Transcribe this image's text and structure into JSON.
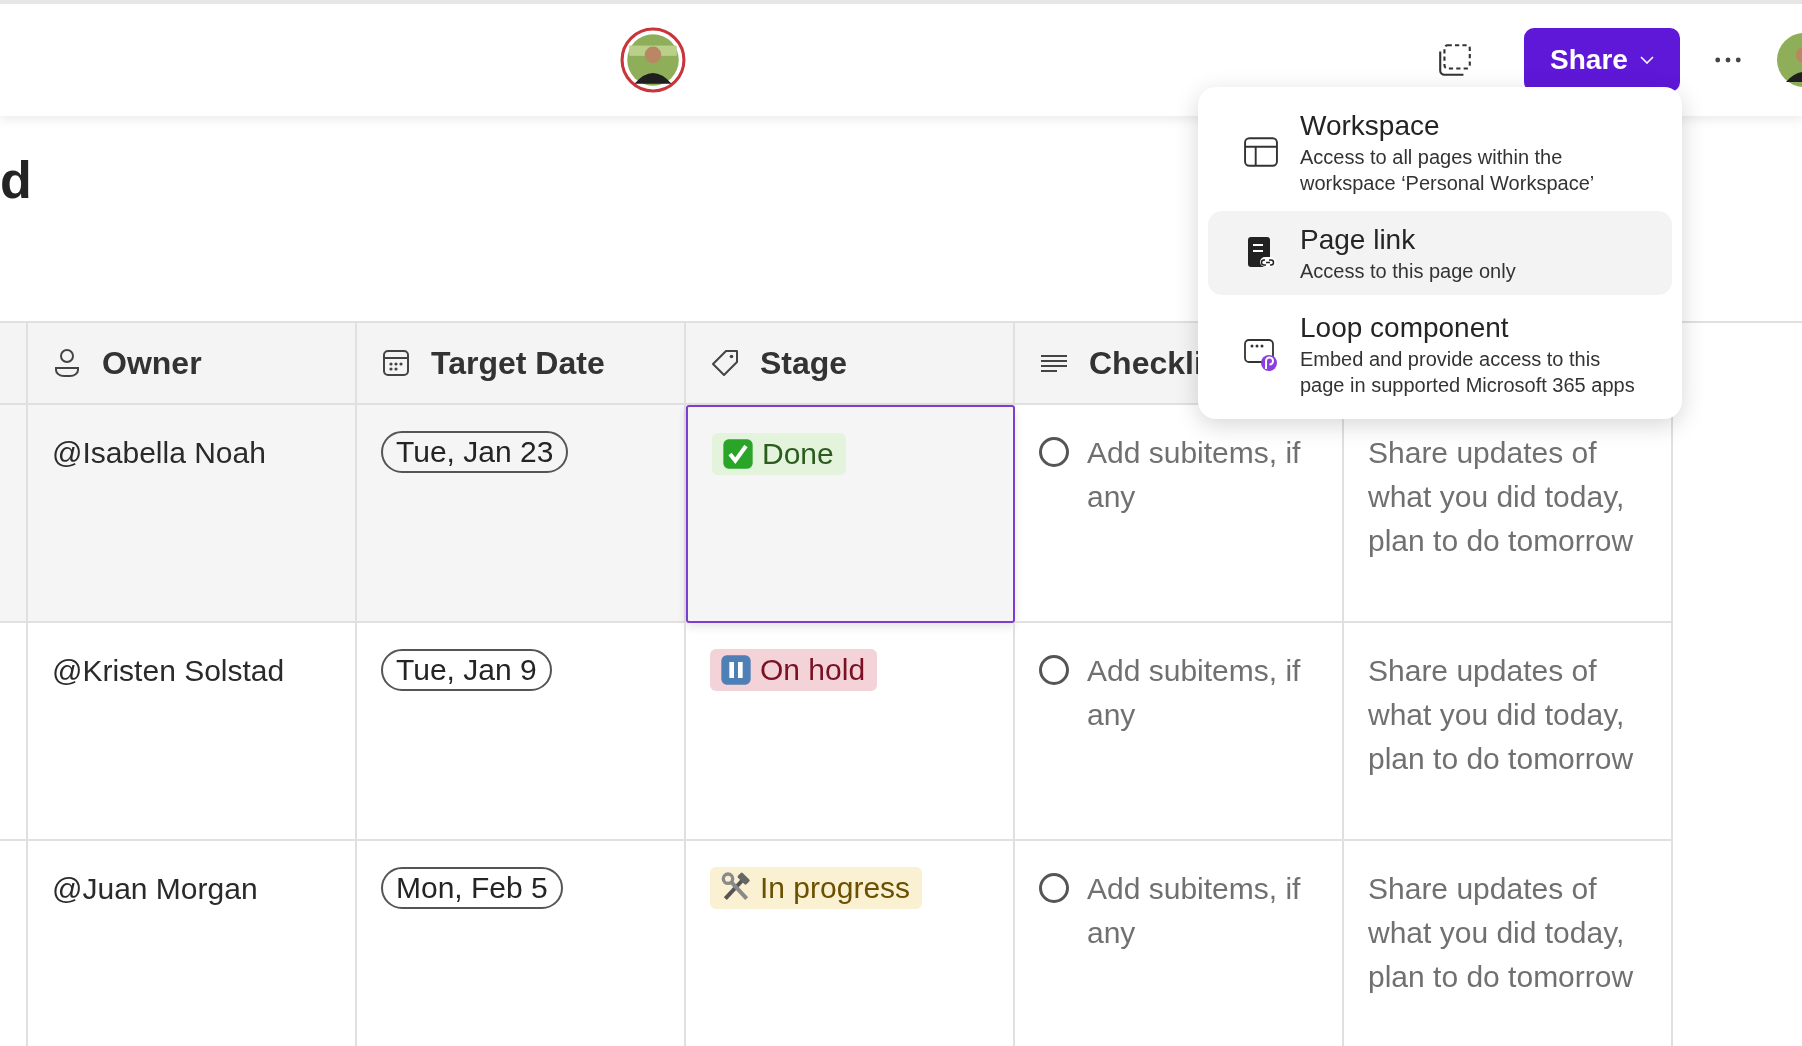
{
  "top_bar": {
    "share_button": {
      "label": "Share"
    }
  },
  "page": {
    "title": "d"
  },
  "table": {
    "columns": [
      {
        "label": "Owner",
        "kind": "person"
      },
      {
        "label": "Target Date",
        "kind": "date"
      },
      {
        "label": "Stage",
        "kind": "tag"
      },
      {
        "label": "Checkli",
        "kind": "lines"
      }
    ],
    "rows": [
      {
        "selected": true,
        "owner": "@Isabella Noah",
        "target_date": "Tue, Jan 23",
        "stage": {
          "label": "Done",
          "kind": "done"
        },
        "checklist": {
          "checked": false,
          "text": "Add subitems, if any"
        },
        "column_5": "Share updates of what you did today, plan to do tomorrow"
      },
      {
        "selected": false,
        "owner": "@Kristen Solstad",
        "target_date": "Tue, Jan 9",
        "stage": {
          "label": "On hold",
          "kind": "on_hold"
        },
        "checklist": {
          "checked": false,
          "text": "Add subitems, if any"
        },
        "column_5": "Share updates of what you did today, plan to do tomorrow"
      },
      {
        "selected": false,
        "owner": "@Juan Morgan",
        "target_date": "Mon, Feb 5",
        "stage": {
          "label": "In progress",
          "kind": "in_progress"
        },
        "checklist": {
          "checked": false,
          "text": "Add subitems, if any"
        },
        "column_5": "Share updates of what you did today, plan to do tomorrow"
      }
    ]
  },
  "share_menu": {
    "items": [
      {
        "kind": "workspace",
        "selected": false,
        "title": "Workspace",
        "description": "Access to all pages within the workspace ‘Personal Workspace’"
      },
      {
        "kind": "page_link",
        "selected": true,
        "title": "Page link",
        "description": "Access to this page only"
      },
      {
        "kind": "loop",
        "selected": false,
        "title": "Loop component",
        "description": "Embed and provide access to this page in supported Microsoft 365 apps"
      }
    ]
  }
}
